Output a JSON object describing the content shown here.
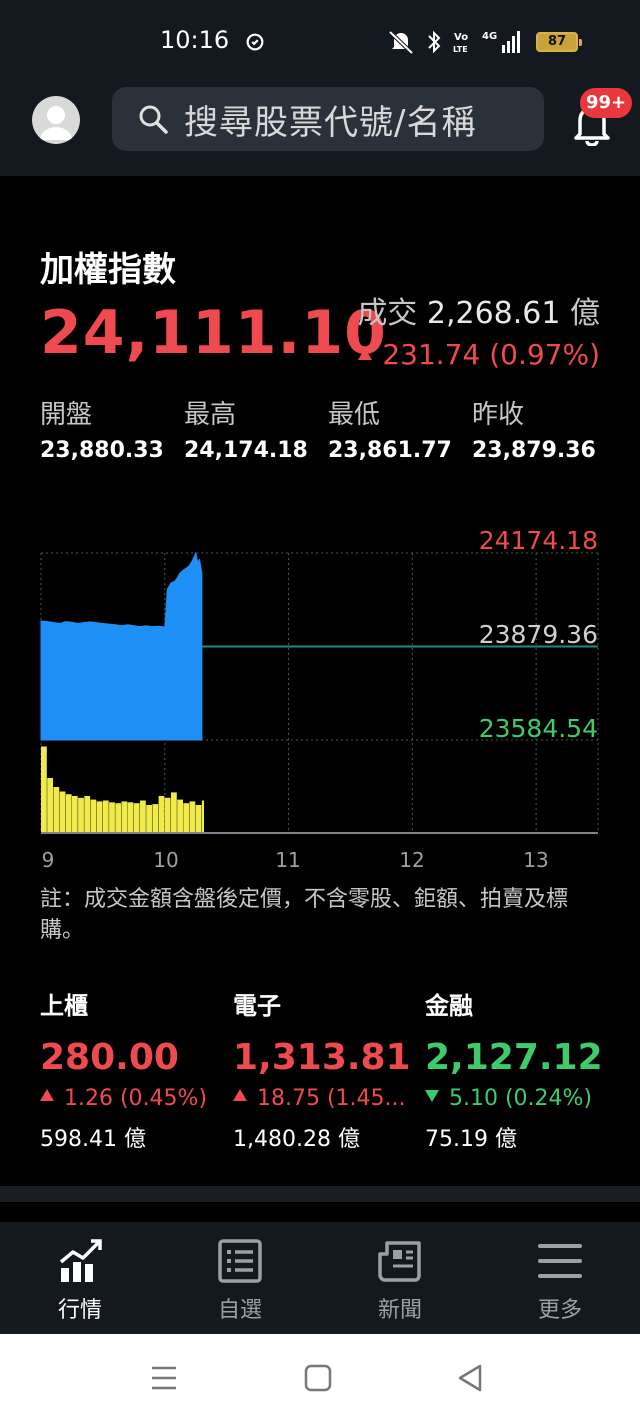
{
  "status_bar": {
    "time": "10:16",
    "network": "4G",
    "battery": "87"
  },
  "header": {
    "search_placeholder": "搜尋股票代號/名稱",
    "notification_badge": "99+"
  },
  "index": {
    "title": "加權指數",
    "price": "24,111.10",
    "volume_label": "成交",
    "volume_value": "2,268.61",
    "volume_unit": "億",
    "change": "231.74 (0.97%)",
    "stats": [
      {
        "label": "開盤",
        "value": "23,880.33"
      },
      {
        "label": "最高",
        "value": "24,174.18"
      },
      {
        "label": "最低",
        "value": "23,861.77"
      },
      {
        "label": "昨收",
        "value": "23,879.36"
      }
    ]
  },
  "chart_data": {
    "type": "area",
    "title": "",
    "xlabel": "",
    "ylabel": "",
    "y_labels": {
      "high": "24174.18",
      "prev_close": "23879.36",
      "low": "23584.54"
    },
    "ylim": [
      23584.54,
      24174.18
    ],
    "x_ticks": [
      "9",
      "10",
      "11",
      "12",
      "13"
    ],
    "price_series": [
      [
        9.0,
        23960
      ],
      [
        9.05,
        23958
      ],
      [
        9.1,
        23955
      ],
      [
        9.15,
        23952
      ],
      [
        9.2,
        23958
      ],
      [
        9.25,
        23956
      ],
      [
        9.3,
        23952
      ],
      [
        9.35,
        23955
      ],
      [
        9.4,
        23957
      ],
      [
        9.45,
        23954
      ],
      [
        9.5,
        23952
      ],
      [
        9.55,
        23950
      ],
      [
        9.6,
        23948
      ],
      [
        9.65,
        23945
      ],
      [
        9.7,
        23948
      ],
      [
        9.75,
        23945
      ],
      [
        9.8,
        23942
      ],
      [
        9.85,
        23945
      ],
      [
        9.9,
        23942
      ],
      [
        9.95,
        23943
      ],
      [
        10.0,
        23941
      ],
      [
        10.02,
        24060
      ],
      [
        10.05,
        24080
      ],
      [
        10.08,
        24085
      ],
      [
        10.1,
        24095
      ],
      [
        10.12,
        24110
      ],
      [
        10.15,
        24120
      ],
      [
        10.18,
        24128
      ],
      [
        10.2,
        24135
      ],
      [
        10.22,
        24148
      ],
      [
        10.24,
        24165
      ],
      [
        10.25,
        24174.18
      ],
      [
        10.27,
        24140
      ],
      [
        10.28,
        24155
      ],
      [
        10.3,
        24111.1
      ]
    ],
    "volume_series": [
      [
        9.0,
        0.95
      ],
      [
        9.05,
        0.6
      ],
      [
        9.1,
        0.5
      ],
      [
        9.15,
        0.45
      ],
      [
        9.2,
        0.42
      ],
      [
        9.25,
        0.4
      ],
      [
        9.3,
        0.38
      ],
      [
        9.35,
        0.4
      ],
      [
        9.4,
        0.36
      ],
      [
        9.45,
        0.34
      ],
      [
        9.5,
        0.35
      ],
      [
        9.55,
        0.33
      ],
      [
        9.6,
        0.32
      ],
      [
        9.65,
        0.34
      ],
      [
        9.7,
        0.33
      ],
      [
        9.75,
        0.32
      ],
      [
        9.8,
        0.35
      ],
      [
        9.85,
        0.3
      ],
      [
        9.9,
        0.31
      ],
      [
        9.95,
        0.4
      ],
      [
        10.0,
        0.38
      ],
      [
        10.05,
        0.44
      ],
      [
        10.1,
        0.36
      ],
      [
        10.15,
        0.32
      ],
      [
        10.2,
        0.34
      ],
      [
        10.25,
        0.3
      ],
      [
        10.3,
        0.35
      ]
    ],
    "colors": {
      "area": "#1e8ff5",
      "volume": "#f0ea4b",
      "high": "#ef4a4f",
      "low": "#3ecb6c",
      "prev_line": "#1f8a83"
    }
  },
  "note": "註：成交金額含盤後定價，不含零股、鉅額、拍賣及標購。",
  "sub_indices": [
    {
      "name": "上櫃",
      "price": "280.00",
      "change": "1.26 (0.45%)",
      "volume": "598.41 億",
      "direction": "up"
    },
    {
      "name": "電子",
      "price": "1,313.81",
      "change": "18.75 (1.45...",
      "volume": "1,480.28 億",
      "direction": "up"
    },
    {
      "name": "金融",
      "price": "2,127.12",
      "change": "5.10 (0.24%)",
      "volume": "75.19 億",
      "direction": "down"
    }
  ],
  "bottom_nav": [
    {
      "label": "行情",
      "icon": "market-chart-icon",
      "active": true
    },
    {
      "label": "自選",
      "icon": "watchlist-icon",
      "active": false
    },
    {
      "label": "新聞",
      "icon": "news-icon",
      "active": false
    },
    {
      "label": "更多",
      "icon": "menu-icon",
      "active": false
    }
  ]
}
